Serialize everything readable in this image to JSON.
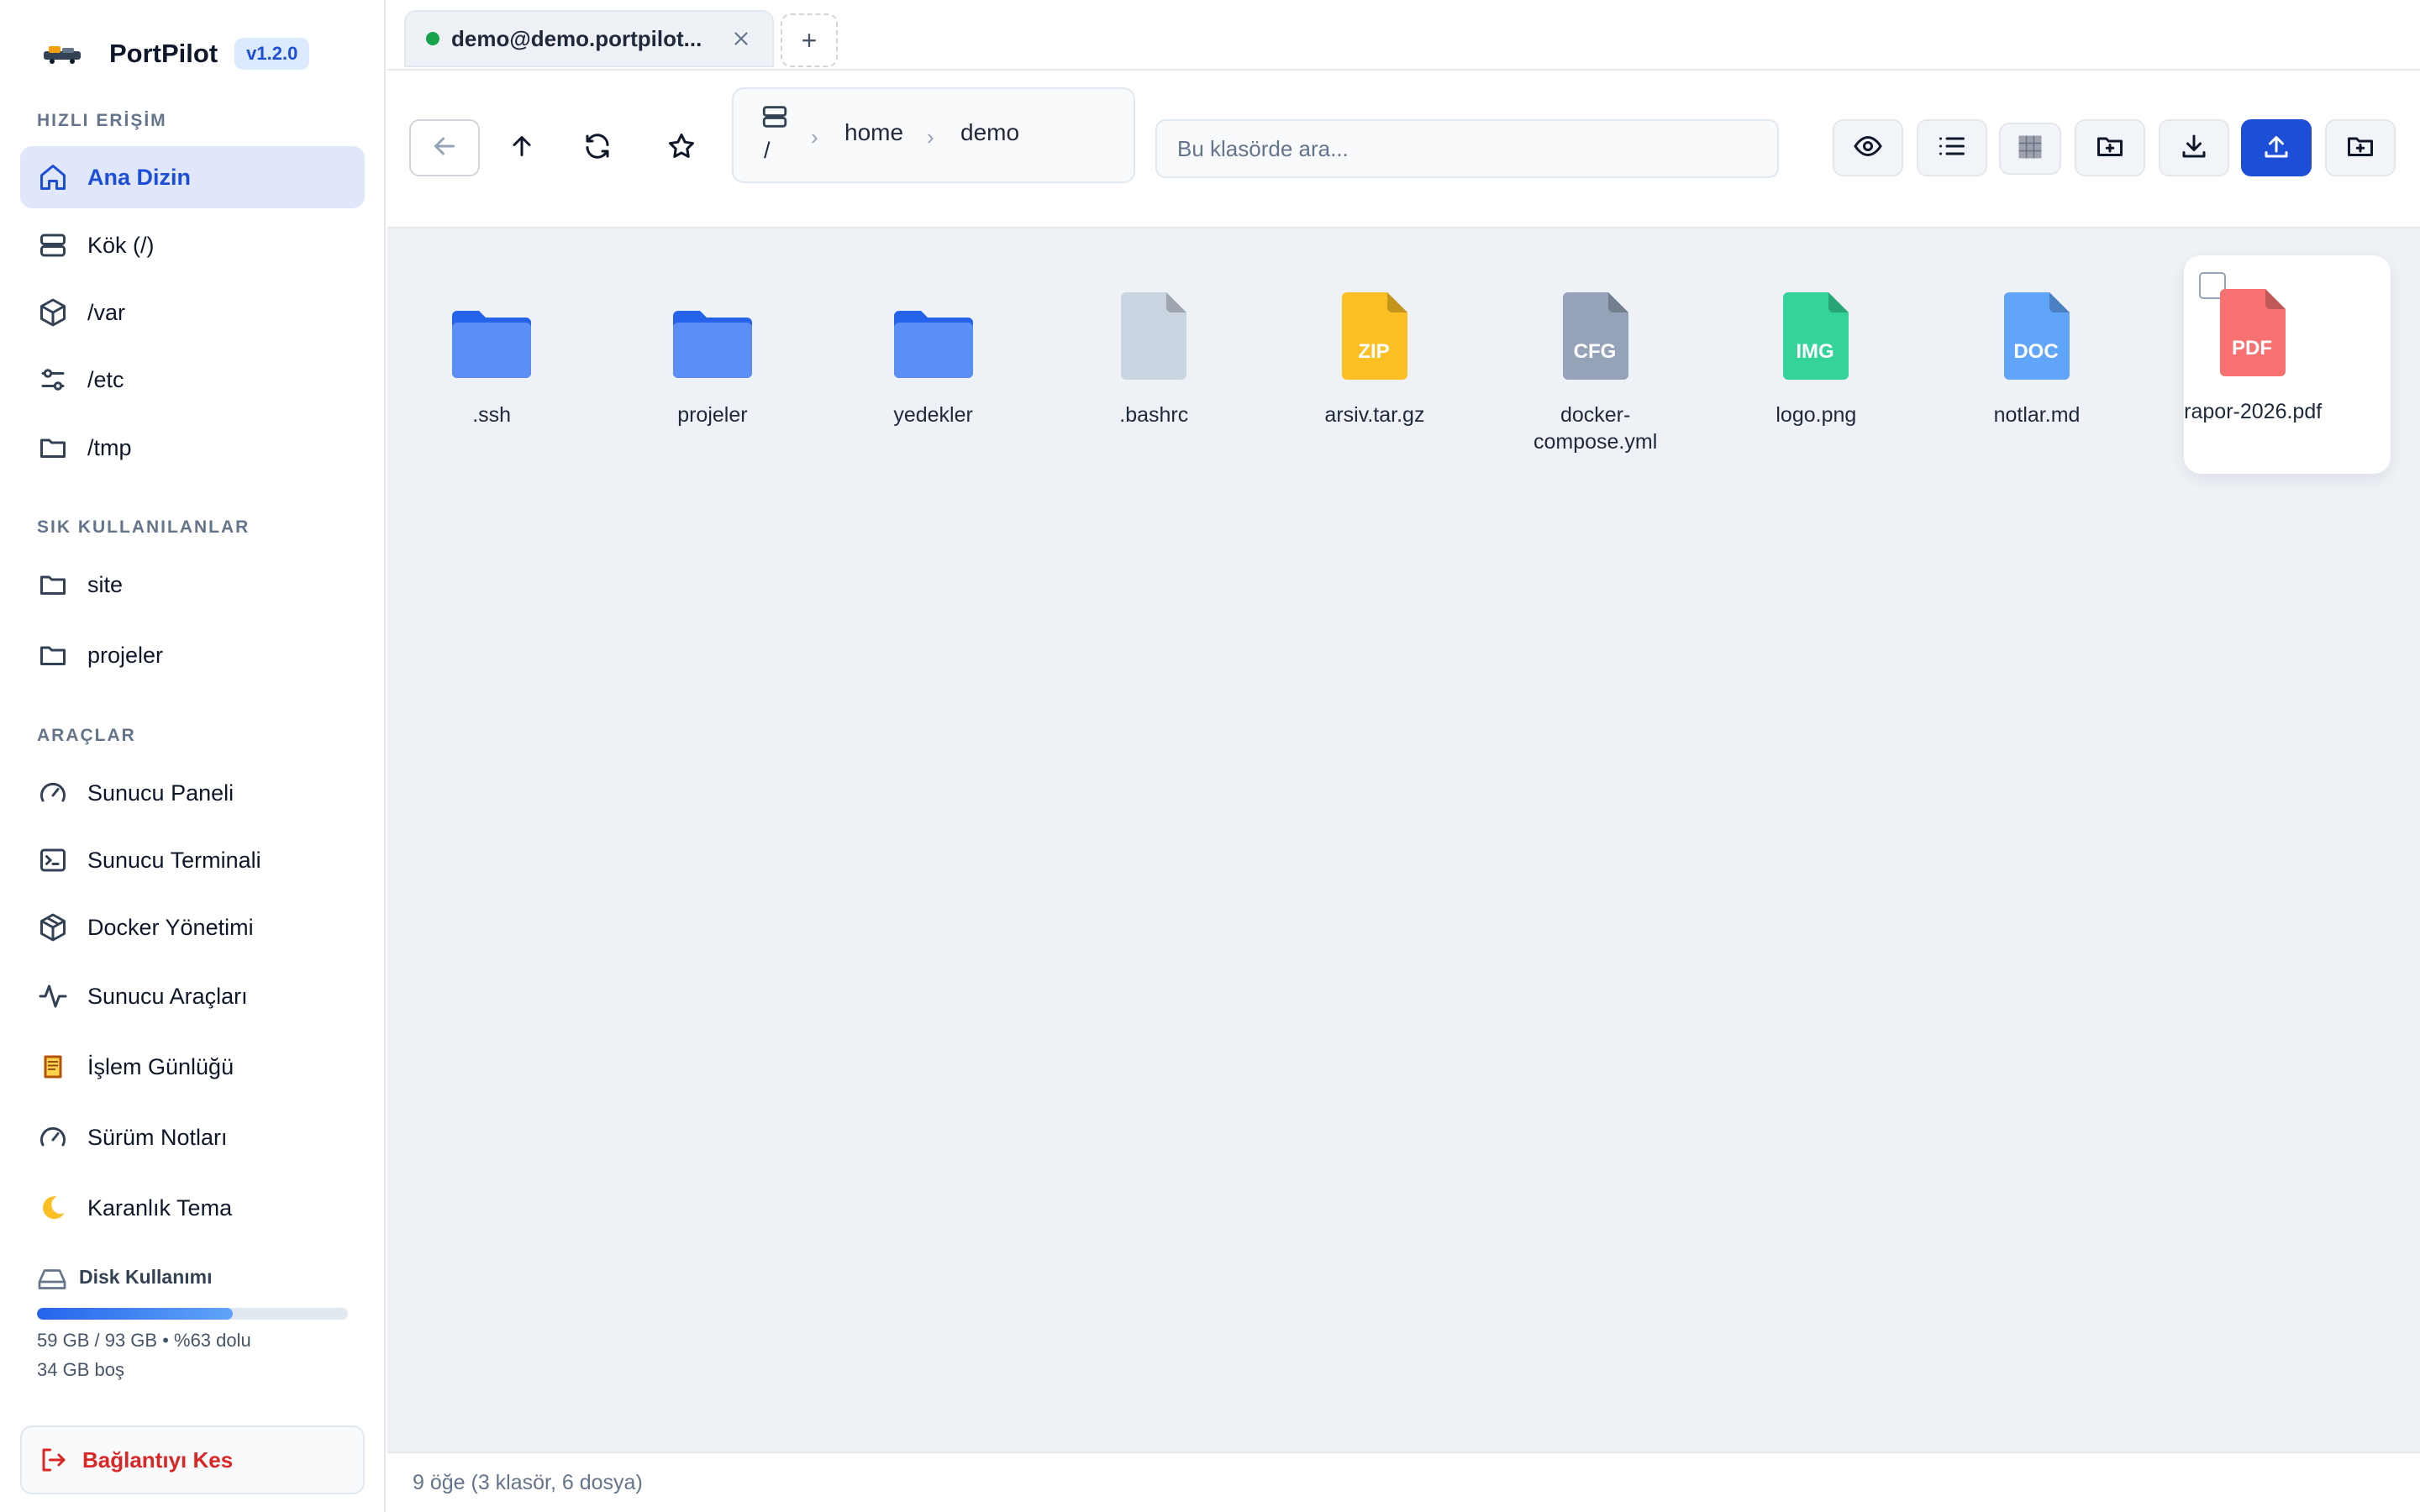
{
  "brand": {
    "name": "PortPilot",
    "version": "v1.2.0"
  },
  "sidebar": {
    "quick_access_title": "HIZLI ERİŞİM",
    "quick_access": [
      {
        "label": "Ana Dizin",
        "icon": "home-icon",
        "active": true
      },
      {
        "label": "Kök (/)",
        "icon": "server-icon"
      },
      {
        "label": "/var",
        "icon": "box-icon"
      },
      {
        "label": "/etc",
        "icon": "sliders-icon"
      },
      {
        "label": "/tmp",
        "icon": "folder-icon"
      }
    ],
    "favorites_title": "SIK KULLANILANLAR",
    "favorites": [
      {
        "label": "site",
        "icon": "folder-icon"
      },
      {
        "label": "projeler",
        "icon": "folder-icon"
      }
    ],
    "tools_title": "ARAÇLAR",
    "tools": [
      {
        "label": "Sunucu Paneli",
        "icon": "gauge-icon"
      },
      {
        "label": "Sunucu Terminali",
        "icon": "terminal-icon"
      },
      {
        "label": "Docker Yönetimi",
        "icon": "container-icon"
      },
      {
        "label": "Sunucu Araçları",
        "icon": "activity-icon"
      },
      {
        "label": "İşlem Günlüğü",
        "icon": "scroll-icon"
      },
      {
        "label": "Sürüm Notları",
        "icon": "gauge-icon"
      },
      {
        "label": "Karanlık Tema",
        "icon": "moon-icon"
      }
    ],
    "disk": {
      "title": "Disk Kullanımı",
      "usage_text": "59 GB / 93 GB • %63 dolu",
      "free_text": "34 GB boş",
      "used_percent": 63
    },
    "disconnect_label": "Bağlantıyı Kes"
  },
  "tabs": {
    "active_title": "demo@demo.portpilot...",
    "status_color": "#16a34a",
    "add_label": "+"
  },
  "toolbar": {
    "breadcrumb_root": "/",
    "breadcrumb": [
      "home",
      "demo"
    ],
    "search_placeholder": "Bu klasörde ara...",
    "accent_color": "#1d4ed8"
  },
  "files": [
    {
      "name": ".ssh",
      "type": "folder"
    },
    {
      "name": "projeler",
      "type": "folder"
    },
    {
      "name": "yedekler",
      "type": "folder"
    },
    {
      "name": ".bashrc",
      "type": "file",
      "badge": "",
      "color": "#cbd5e1"
    },
    {
      "name": "arsiv.tar.gz",
      "type": "file",
      "badge": "ZIP",
      "color": "#fbbf24"
    },
    {
      "name": "docker-compose.yml",
      "type": "file",
      "badge": "CFG",
      "color": "#94a3b8"
    },
    {
      "name": "logo.png",
      "type": "file",
      "badge": "IMG",
      "color": "#34d399"
    },
    {
      "name": "notlar.md",
      "type": "file",
      "badge": "DOC",
      "color": "#60a5fa"
    },
    {
      "name": "rapor-2026.pdf",
      "type": "file",
      "badge": "PDF",
      "color": "#f87171",
      "hovered": true
    }
  ],
  "status": {
    "summary": "9 öğe (3 klasör, 6 dosya)"
  }
}
